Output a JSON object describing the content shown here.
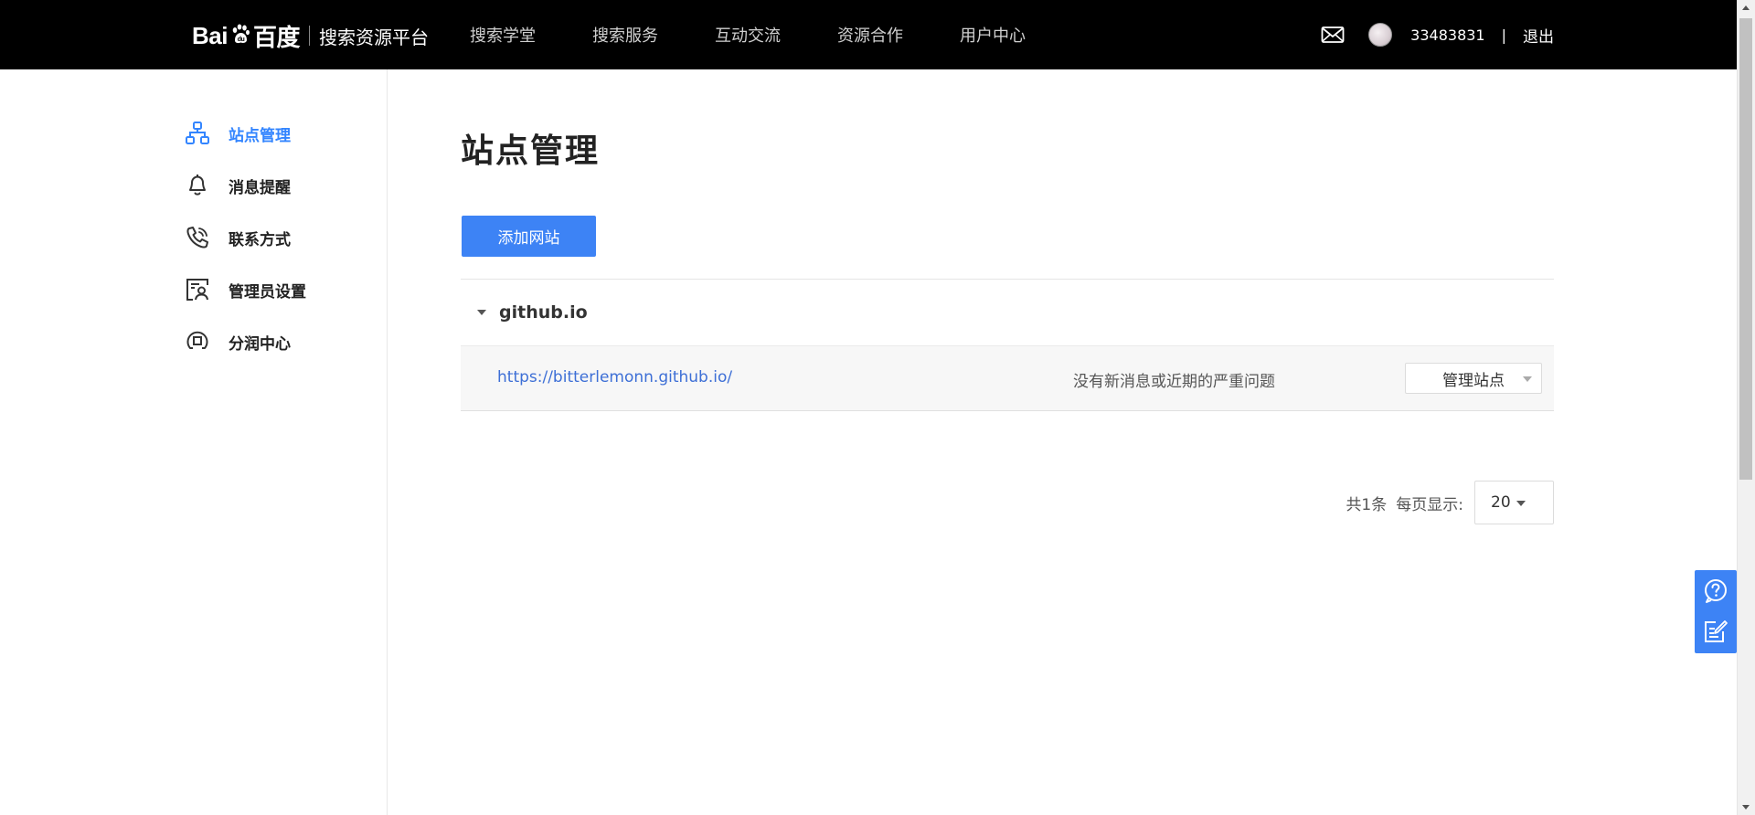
{
  "header": {
    "logo_text_left": "Bai",
    "logo_text_right": "百度",
    "platform_title": "搜索资源平台",
    "nav": [
      {
        "label": "搜索学堂"
      },
      {
        "label": "搜索服务"
      },
      {
        "label": "互动交流"
      },
      {
        "label": "资源合作"
      },
      {
        "label": "用户中心"
      }
    ],
    "username": "33483831",
    "separator": "|",
    "logout": "退出"
  },
  "sidebar": {
    "items": [
      {
        "label": "站点管理",
        "icon": "sitemap-icon",
        "active": true
      },
      {
        "label": "消息提醒",
        "icon": "bell-icon",
        "active": false
      },
      {
        "label": "联系方式",
        "icon": "phone-icon",
        "active": false
      },
      {
        "label": "管理员设置",
        "icon": "admin-icon",
        "active": false
      },
      {
        "label": "分润中心",
        "icon": "revenue-icon",
        "active": false
      }
    ]
  },
  "main": {
    "title": "站点管理",
    "add_button": "添加网站",
    "groups": [
      {
        "name": "github.io",
        "sites": [
          {
            "url": "https://bitterlemonn.github.io/",
            "status": "没有新消息或近期的严重问题",
            "action": "管理站点"
          }
        ]
      }
    ],
    "pagination": {
      "total": "共1条",
      "per_page_label": "每页显示:",
      "per_page_value": "20"
    }
  },
  "colors": {
    "accent": "#3d83f5",
    "active_text": "#3385ff",
    "link": "#3d6fd6",
    "header_bg": "#000000"
  }
}
